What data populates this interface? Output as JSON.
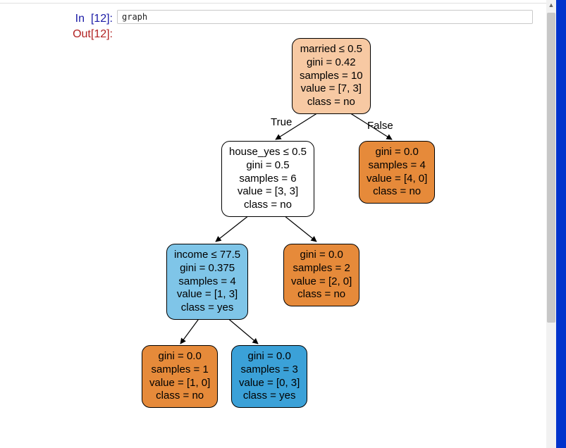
{
  "cell": {
    "in_prompt": "In  [12]:",
    "out_prompt": "Out[12]:",
    "code": "graph"
  },
  "tree": {
    "edge_true": "True",
    "edge_false": "False",
    "nodes": {
      "root": {
        "line1": "married ≤ 0.5",
        "line2": "gini = 0.42",
        "line3": "samples = 10",
        "line4": "value = [7, 3]",
        "line5": "class = no"
      },
      "left1": {
        "line1": "house_yes ≤ 0.5",
        "line2": "gini = 0.5",
        "line3": "samples = 6",
        "line4": "value = [3, 3]",
        "line5": "class = no"
      },
      "right1": {
        "line1": "gini = 0.0",
        "line2": "samples = 4",
        "line3": "value = [4, 0]",
        "line4": "class = no"
      },
      "left2": {
        "line1": "income ≤ 77.5",
        "line2": "gini = 0.375",
        "line3": "samples = 4",
        "line4": "value = [1, 3]",
        "line5": "class = yes"
      },
      "right2": {
        "line1": "gini = 0.0",
        "line2": "samples = 2",
        "line3": "value = [2, 0]",
        "line4": "class = no"
      },
      "leaf_l": {
        "line1": "gini = 0.0",
        "line2": "samples = 1",
        "line3": "value = [1, 0]",
        "line4": "class = no"
      },
      "leaf_r": {
        "line1": "gini = 0.0",
        "line2": "samples = 3",
        "line3": "value = [0, 3]",
        "line4": "class = yes"
      }
    }
  },
  "colors": {
    "light_orange": "#f7c9a3",
    "orange": "#e68a3a",
    "white": "#ffffff",
    "light_blue": "#7fc5e8",
    "blue": "#3ba1d8"
  }
}
